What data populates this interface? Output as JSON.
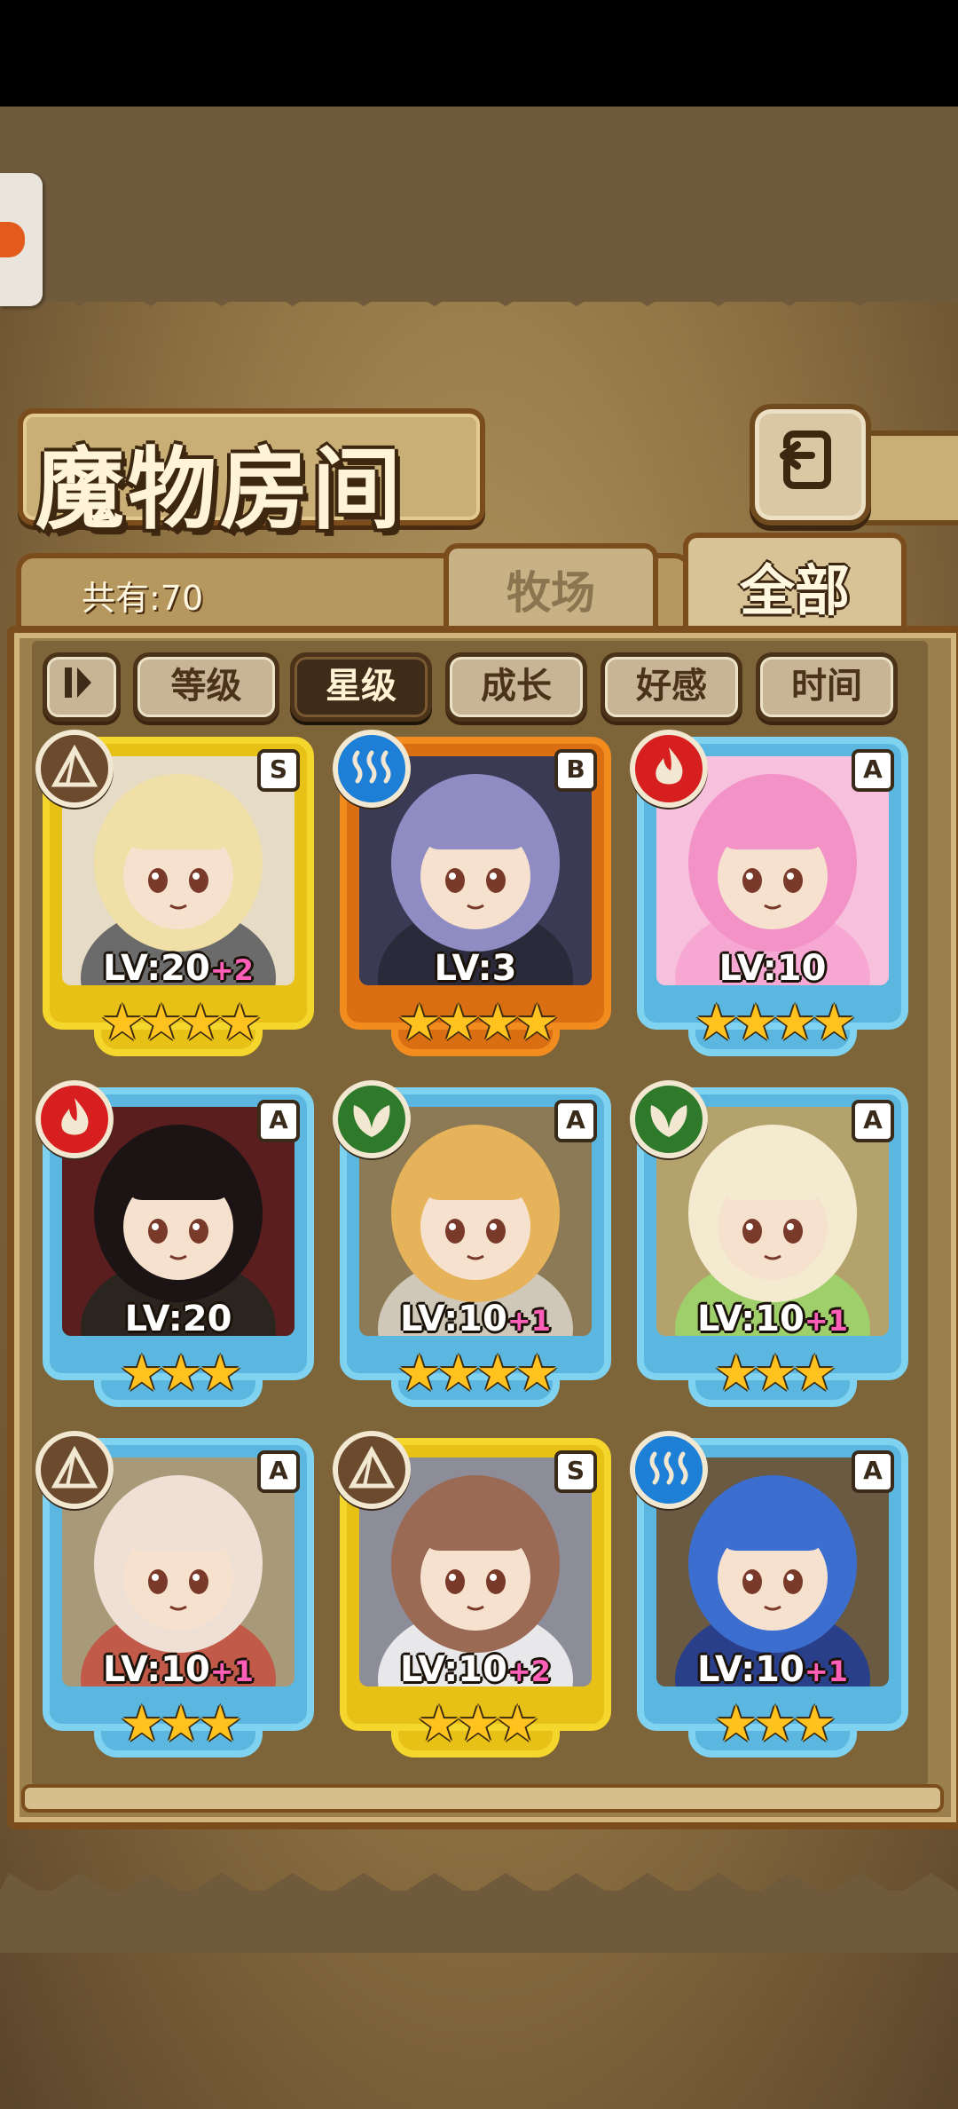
{
  "header": {
    "title": "魔物房间",
    "back_icon": "return-arrow-icon"
  },
  "summary": {
    "count_label": "共有:70"
  },
  "tabs": [
    {
      "label": "牧场",
      "active": false
    },
    {
      "label": "全部",
      "active": true
    }
  ],
  "sort_buttons": [
    {
      "label": "等级",
      "active": false
    },
    {
      "label": "星级",
      "active": true
    },
    {
      "label": "成长",
      "active": false
    },
    {
      "label": "好感",
      "active": false
    },
    {
      "label": "时间",
      "active": false
    }
  ],
  "cards": [
    {
      "grade": "S",
      "element": "earth",
      "element_color": "#6b4a2e",
      "frame": "gold",
      "level": "LV:20",
      "bonus": "+2",
      "stars": "★★★★",
      "art_color": "#e6dcc6",
      "hair": "#f0dfa6",
      "outfit": "#6b6b6b"
    },
    {
      "grade": "B",
      "element": "water",
      "element_color": "#1e7fd6",
      "frame": "orange",
      "level": "LV:3",
      "bonus": "",
      "stars": "★★★★",
      "art_color": "#3b3a55",
      "hair": "#8e8cc2",
      "outfit": "#2a2a3a"
    },
    {
      "grade": "A",
      "element": "fire",
      "element_color": "#d81f1f",
      "frame": "blue",
      "level": "LV:10",
      "bonus": "",
      "stars": "★★★★",
      "art_color": "#f7c0dc",
      "hair": "#f292c6",
      "outfit": "#f7a8d2"
    },
    {
      "grade": "A",
      "element": "fire",
      "element_color": "#d81f1f",
      "frame": "blue",
      "level": "LV:20",
      "bonus": "",
      "stars": "★★★",
      "art_color": "#5a1e1e",
      "hair": "#1c1414",
      "outfit": "#2b2520"
    },
    {
      "grade": "A",
      "element": "wood",
      "element_color": "#2f7a2a",
      "frame": "blue",
      "level": "LV:10",
      "bonus": "+1",
      "stars": "★★★★",
      "art_color": "#8b7a55",
      "hair": "#e6b35a",
      "outfit": "#cfc8b8"
    },
    {
      "grade": "A",
      "element": "wood",
      "element_color": "#2f7a2a",
      "frame": "blue",
      "level": "LV:10",
      "bonus": "+1",
      "stars": "★★★",
      "art_color": "#b4a26d",
      "hair": "#f4ead0",
      "outfit": "#9fcf6a"
    },
    {
      "grade": "A",
      "element": "earth",
      "element_color": "#6b4a2e",
      "frame": "blue",
      "level": "LV:10",
      "bonus": "+1",
      "stars": "★★★",
      "art_color": "#a89a78",
      "hair": "#efe0d6",
      "outfit": "#c25a4a"
    },
    {
      "grade": "S",
      "element": "earth",
      "element_color": "#6b4a2e",
      "frame": "gold",
      "level": "LV:10",
      "bonus": "+2",
      "stars": "★★★",
      "art_color": "#8d8d9a",
      "hair": "#9a6a55",
      "outfit": "#e8e8ea"
    },
    {
      "grade": "A",
      "element": "water",
      "element_color": "#1e7fd6",
      "frame": "blue",
      "level": "LV:10",
      "bonus": "+1",
      "stars": "★★★",
      "art_color": "#6a5a42",
      "hair": "#3c6ed0",
      "outfit": "#2a3f8a"
    }
  ]
}
